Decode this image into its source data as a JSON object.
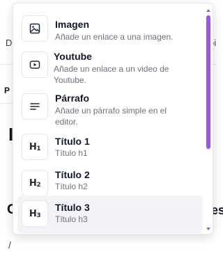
{
  "background": {
    "fragments": [
      "D",
      "oi",
      "P",
      "I",
      "C",
      "es",
      "/"
    ]
  },
  "menu": {
    "items": [
      {
        "icon": "image-icon",
        "title": "Imagen",
        "desc": "Añade un enlace a una imagen."
      },
      {
        "icon": "youtube-icon",
        "title": "Youtube",
        "desc": "Añade un enlace a un video de Youtube."
      },
      {
        "icon": "paragraph-icon",
        "title": "Párrafo",
        "desc": "Añade un párrafo simple en el editor."
      },
      {
        "icon": "heading-1-icon",
        "glyph": "H",
        "sub": "1",
        "title": "Título 1",
        "desc": "Título h1"
      },
      {
        "icon": "heading-2-icon",
        "glyph": "H",
        "sub": "2",
        "title": "Título 2",
        "desc": "Título h2"
      },
      {
        "icon": "heading-3-icon",
        "glyph": "H",
        "sub": "3",
        "title": "Título 3",
        "desc": "Título h3"
      }
    ],
    "scrollbar_color": "#9b59d8",
    "highlight_color": "#f3f3f7"
  }
}
